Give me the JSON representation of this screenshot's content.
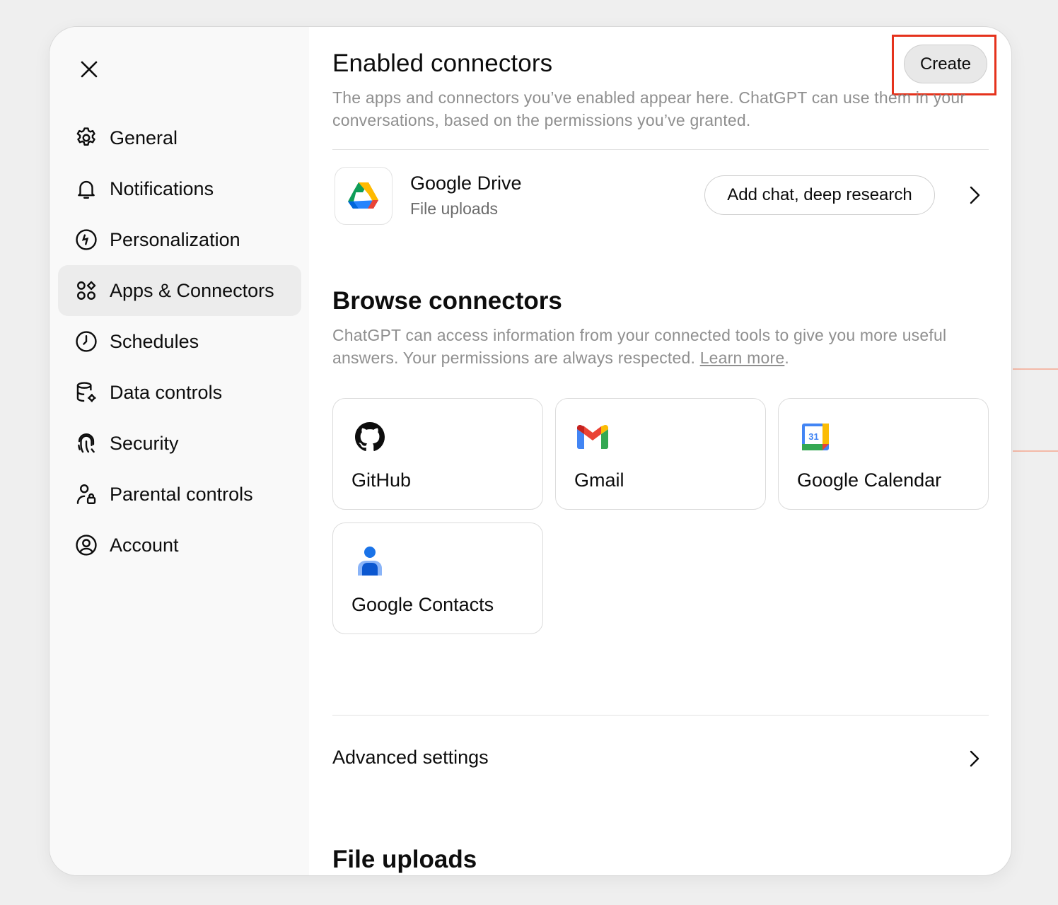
{
  "sidebar": {
    "items": [
      {
        "label": "General",
        "icon": "gear-icon"
      },
      {
        "label": "Notifications",
        "icon": "bell-icon"
      },
      {
        "label": "Personalization",
        "icon": "personalization-icon"
      },
      {
        "label": "Apps & Connectors",
        "icon": "apps-icon",
        "active": true
      },
      {
        "label": "Schedules",
        "icon": "clock-icon"
      },
      {
        "label": "Data controls",
        "icon": "database-icon"
      },
      {
        "label": "Security",
        "icon": "fingerprint-icon"
      },
      {
        "label": "Parental controls",
        "icon": "parental-controls-icon"
      },
      {
        "label": "Account",
        "icon": "account-icon"
      }
    ]
  },
  "enabled": {
    "title": "Enabled connectors",
    "create_label": "Create",
    "description": "The apps and connectors you’ve enabled appear here. ChatGPT can use them in your conversations, based on the permissions you’ve granted.",
    "connector": {
      "name": "Google Drive",
      "subtitle": "File uploads",
      "action_label": "Add chat, deep research"
    }
  },
  "browse": {
    "title": "Browse connectors",
    "description": "ChatGPT can access information from your connected tools to give you more useful answers. Your permissions are always respected.",
    "learn_more": "Learn more",
    "period": ".",
    "cards": [
      {
        "name": "GitHub",
        "icon": "github-icon"
      },
      {
        "name": "Gmail",
        "icon": "gmail-icon"
      },
      {
        "name": "Google Calendar",
        "icon": "google-calendar-icon",
        "icon_text": "31"
      },
      {
        "name": "Google Contacts",
        "icon": "google-contacts-icon"
      }
    ]
  },
  "advanced": {
    "label": "Advanced settings"
  },
  "file_uploads": {
    "title": "File uploads"
  },
  "colors": {
    "highlight": "#e5321c",
    "active_nav": "#ececec",
    "muted_text": "#8f8f8f"
  }
}
